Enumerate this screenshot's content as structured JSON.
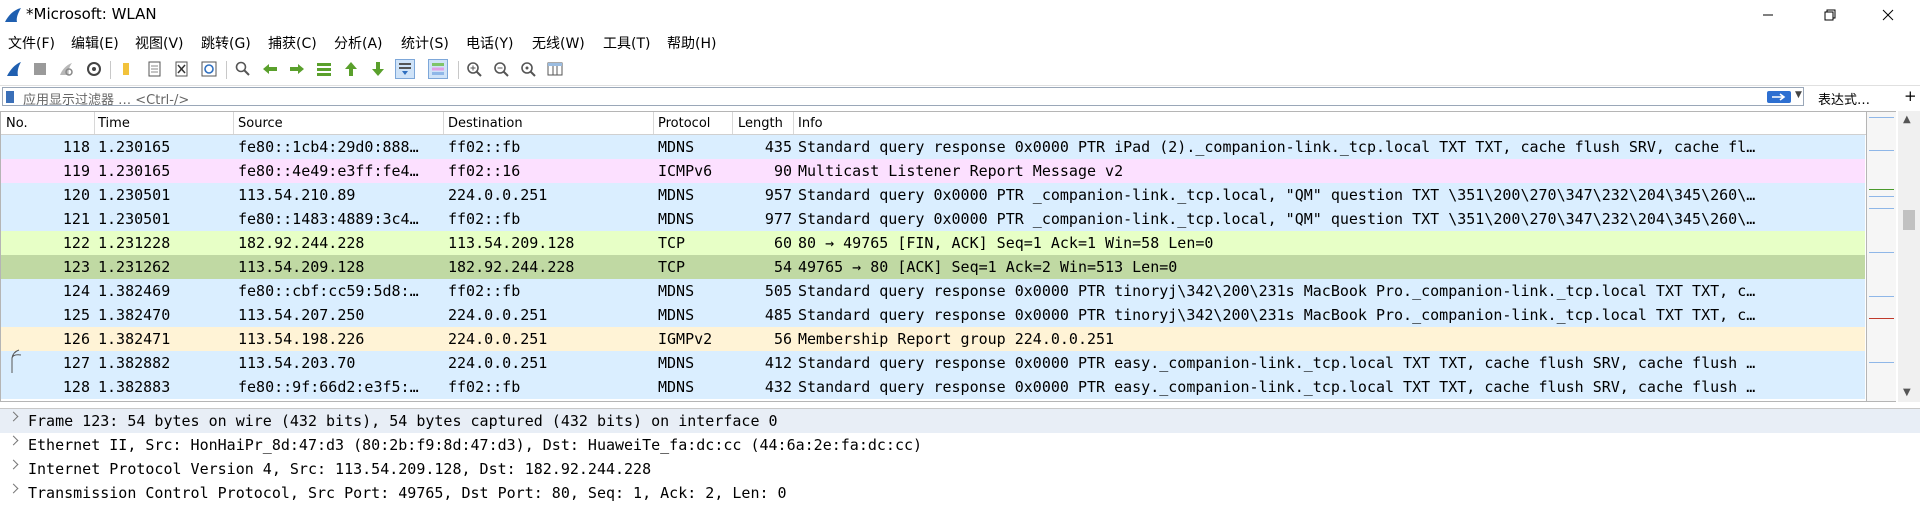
{
  "window": {
    "title": "*Microsoft: WLAN"
  },
  "menu": [
    "文件(F)",
    "编辑(E)",
    "视图(V)",
    "跳转(G)",
    "捕获(C)",
    "分析(A)",
    "统计(S)",
    "电话(Y)",
    "无线(W)",
    "工具(T)",
    "帮助(H)"
  ],
  "toolbar": {
    "icons": [
      "shark-fin-start-icon",
      "stop-capture-icon",
      "restart-capture-icon",
      "capture-options-icon",
      "open-file-icon",
      "file-icon",
      "close-file-icon",
      "reload-icon",
      "find-packet-icon",
      "go-back-icon",
      "go-forward-icon",
      "go-to-packet-icon",
      "go-first-icon",
      "go-last-icon",
      "autoscroll-icon",
      "colorize-icon",
      "zoom-in-icon",
      "zoom-out-icon",
      "zoom-normal-icon",
      "resize-columns-icon"
    ]
  },
  "filter": {
    "placeholder": "应用显示过滤器 … <Ctrl-/>",
    "expression_label": "表达式…",
    "plus_label": "+"
  },
  "columns": [
    "No.",
    "Time",
    "Source",
    "Destination",
    "Protocol",
    "Length",
    "Info"
  ],
  "packets": [
    {
      "no": "118",
      "time": "1.230165",
      "src": "fe80::1cb4:29d0:888…",
      "dst": "ff02::fb",
      "proto": "MDNS",
      "len": "435",
      "info": "Standard query response 0x0000 PTR iPad (2)._companion-link._tcp.local TXT TXT, cache flush SRV, cache fl…",
      "bg": "#daeeff"
    },
    {
      "no": "119",
      "time": "1.230165",
      "src": "fe80::4e49:e3ff:fe4…",
      "dst": "ff02::16",
      "proto": "ICMPv6",
      "len": "90",
      "info": "Multicast Listener Report Message v2",
      "bg": "#fce0ff"
    },
    {
      "no": "120",
      "time": "1.230501",
      "src": "113.54.210.89",
      "dst": "224.0.0.251",
      "proto": "MDNS",
      "len": "957",
      "info": "Standard query 0x0000 PTR _companion-link._tcp.local, \"QM\" question TXT \\351\\200\\270\\347\\232\\204\\345\\260\\…",
      "bg": "#daeeff"
    },
    {
      "no": "121",
      "time": "1.230501",
      "src": "fe80::1483:4889:3c4…",
      "dst": "ff02::fb",
      "proto": "MDNS",
      "len": "977",
      "info": "Standard query 0x0000 PTR _companion-link._tcp.local, \"QM\" question TXT \\351\\200\\270\\347\\232\\204\\345\\260\\…",
      "bg": "#daeeff"
    },
    {
      "no": "122",
      "time": "1.231228",
      "src": "182.92.244.228",
      "dst": "113.54.209.128",
      "proto": "TCP",
      "len": "60",
      "info": "80 → 49765 [FIN, ACK] Seq=1 Ack=1 Win=58 Len=0",
      "bg": "#e7ffc6"
    },
    {
      "no": "123",
      "time": "1.231262",
      "src": "113.54.209.128",
      "dst": "182.92.244.228",
      "proto": "TCP",
      "len": "54",
      "info": "49765 → 80 [ACK] Seq=1 Ack=2 Win=513 Len=0",
      "bg": "#c0d9a3"
    },
    {
      "no": "124",
      "time": "1.382469",
      "src": "fe80::cbf:cc59:5d8:…",
      "dst": "ff02::fb",
      "proto": "MDNS",
      "len": "505",
      "info": "Standard query response 0x0000 PTR tinoryj\\342\\200\\231s MacBook Pro._companion-link._tcp.local TXT TXT, c…",
      "bg": "#daeeff"
    },
    {
      "no": "125",
      "time": "1.382470",
      "src": "113.54.207.250",
      "dst": "224.0.0.251",
      "proto": "MDNS",
      "len": "485",
      "info": "Standard query response 0x0000 PTR tinoryj\\342\\200\\231s MacBook Pro._companion-link._tcp.local TXT TXT, c…",
      "bg": "#daeeff"
    },
    {
      "no": "126",
      "time": "1.382471",
      "src": "113.54.198.226",
      "dst": "224.0.0.251",
      "proto": "IGMPv2",
      "len": "56",
      "info": "Membership Report group 224.0.0.251",
      "bg": "#fff3d6"
    },
    {
      "no": "127",
      "time": "1.382882",
      "src": "113.54.203.70",
      "dst": "224.0.0.251",
      "proto": "MDNS",
      "len": "412",
      "info": "Standard query response 0x0000 PTR easy._companion-link._tcp.local TXT TXT, cache flush SRV, cache flush …",
      "bg": "#daeeff"
    },
    {
      "no": "128",
      "time": "1.382883",
      "src": "fe80::9f:66d2:e3f5:…",
      "dst": "ff02::fb",
      "proto": "MDNS",
      "len": "432",
      "info": "Standard query response 0x0000 PTR easy._companion-link._tcp.local TXT TXT, cache flush SRV, cache flush …",
      "bg": "#daeeff"
    }
  ],
  "selected_packet": "123",
  "details": [
    {
      "text": "Frame 123: 54 bytes on wire (432 bits), 54 bytes captured (432 bits) on interface 0",
      "bg": "#e8eef6"
    },
    {
      "text": "Ethernet II, Src: HonHaiPr_8d:47:d3 (80:2b:f9:8d:47:d3), Dst: HuaweiTe_fa:dc:cc (44:6a:2e:fa:dc:cc)",
      "bg": "#ffffff"
    },
    {
      "text": "Internet Protocol Version 4, Src: 113.54.209.128, Dst: 182.92.244.228",
      "bg": "#ffffff"
    },
    {
      "text": "Transmission Control Protocol, Src Port: 49765, Dst Port: 80, Seq: 1, Ack: 2, Len: 0",
      "bg": "#ffffff"
    }
  ]
}
